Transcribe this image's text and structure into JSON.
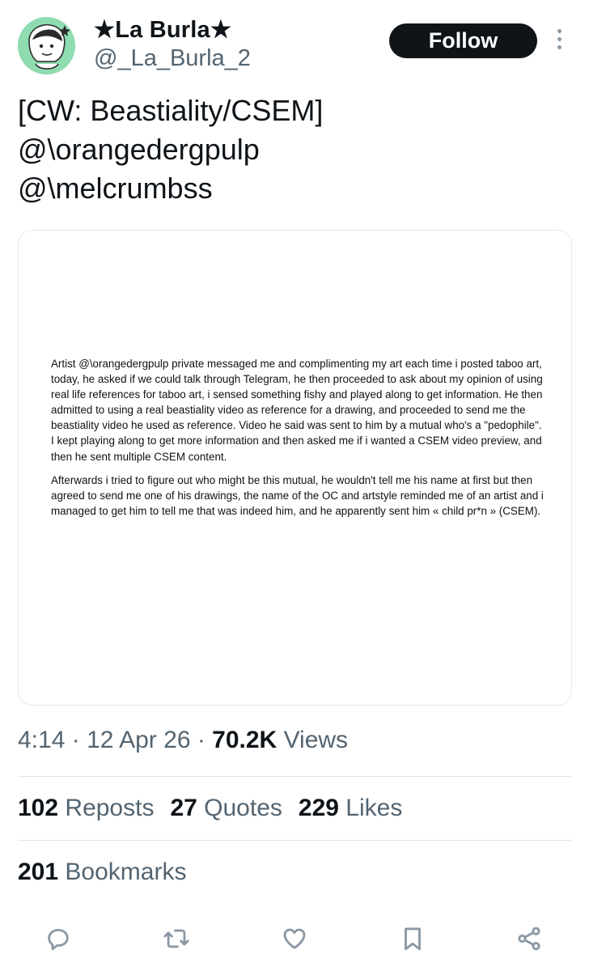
{
  "author": {
    "display_name": "★La Burla★",
    "handle": "@_La_Burla_2",
    "avatar_icon": "avatar-icon"
  },
  "follow_label": "Follow",
  "tweet": {
    "lines": [
      "[CW: Beastiality/CSEM]",
      "@\\orangedergpulp",
      "@\\melcrumbss"
    ]
  },
  "document": {
    "paragraphs": [
      "Artist @\\orangedergpulp private messaged me and complimenting my art each time i posted taboo art, today, he asked if we could talk through Telegram, he then proceeded to ask about my opinion of using real life references for taboo art, i sensed something fishy and played along to get information. He then admitted to using a real beastiality video as reference for a drawing, and proceeded to send me the beastiality video he used as reference. Video he said was sent to him by a mutual who's a \"pedophile\". I kept playing along to get more information and then asked me if i wanted a CSEM video preview, and then he sent multiple CSEM content.",
      "Afterwards i tried to figure out who might be this mutual, he wouldn't tell me his name at first but then agreed to send me one of his drawings, the name of the OC and artstyle reminded me of an artist and i managed to get him to tell me that was indeed him, and he apparently sent him « child pr*n » (CSEM)."
    ]
  },
  "meta": {
    "time": "4:14",
    "sep1": " · ",
    "date": "12 Apr 26",
    "sep2": " · ",
    "views_count": "70.2K",
    "views_label": " Views"
  },
  "stats": {
    "reposts_count": "102",
    "reposts_label": " Reposts",
    "quotes_count": "27",
    "quotes_label": " Quotes",
    "likes_count": "229",
    "likes_label": " Likes",
    "bookmarks_count": "201",
    "bookmarks_label": " Bookmarks"
  },
  "actions": [
    "reply-icon",
    "repost-icon",
    "like-icon",
    "bookmark-icon",
    "share-icon"
  ],
  "colors": {
    "text": "#0f1419",
    "secondary": "#536471",
    "icon": "#8b98a5",
    "avatar_bg": "#8fdcb0"
  }
}
